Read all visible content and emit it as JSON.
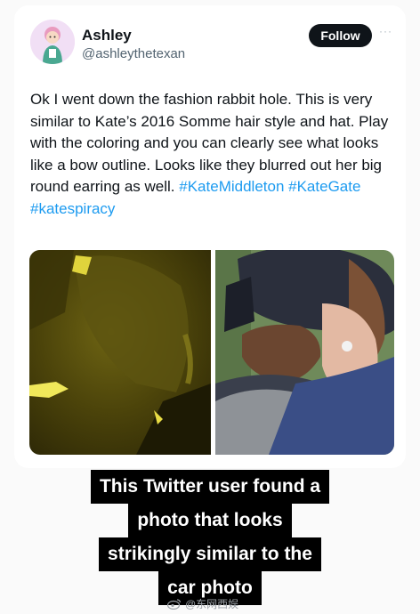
{
  "post": {
    "author_name": "Ashley",
    "author_handle": "@ashleythetexan",
    "follow_label": "Follow",
    "more_label": "···",
    "text_main": "Ok I went down the fashion rabbit hole. This is very similar to Kate’s 2016 Somme hair style and hat. Play with the coloring and you can clearly see what looks like a bow outline. Looks like they blurred out her big round earring as well. ",
    "hashtags": [
      "#KateMiddleton",
      "#KateGate",
      "#katespiracy"
    ]
  },
  "caption": {
    "lines": [
      "This Twitter user found a",
      "photo that looks",
      "strikingly similar to the",
      "car photo"
    ]
  },
  "watermark": {
    "text": "@东网西娱"
  },
  "colors": {
    "hashtag": "#1d9bf0",
    "follow_bg": "#0f1419",
    "caption_bg": "#000000"
  }
}
